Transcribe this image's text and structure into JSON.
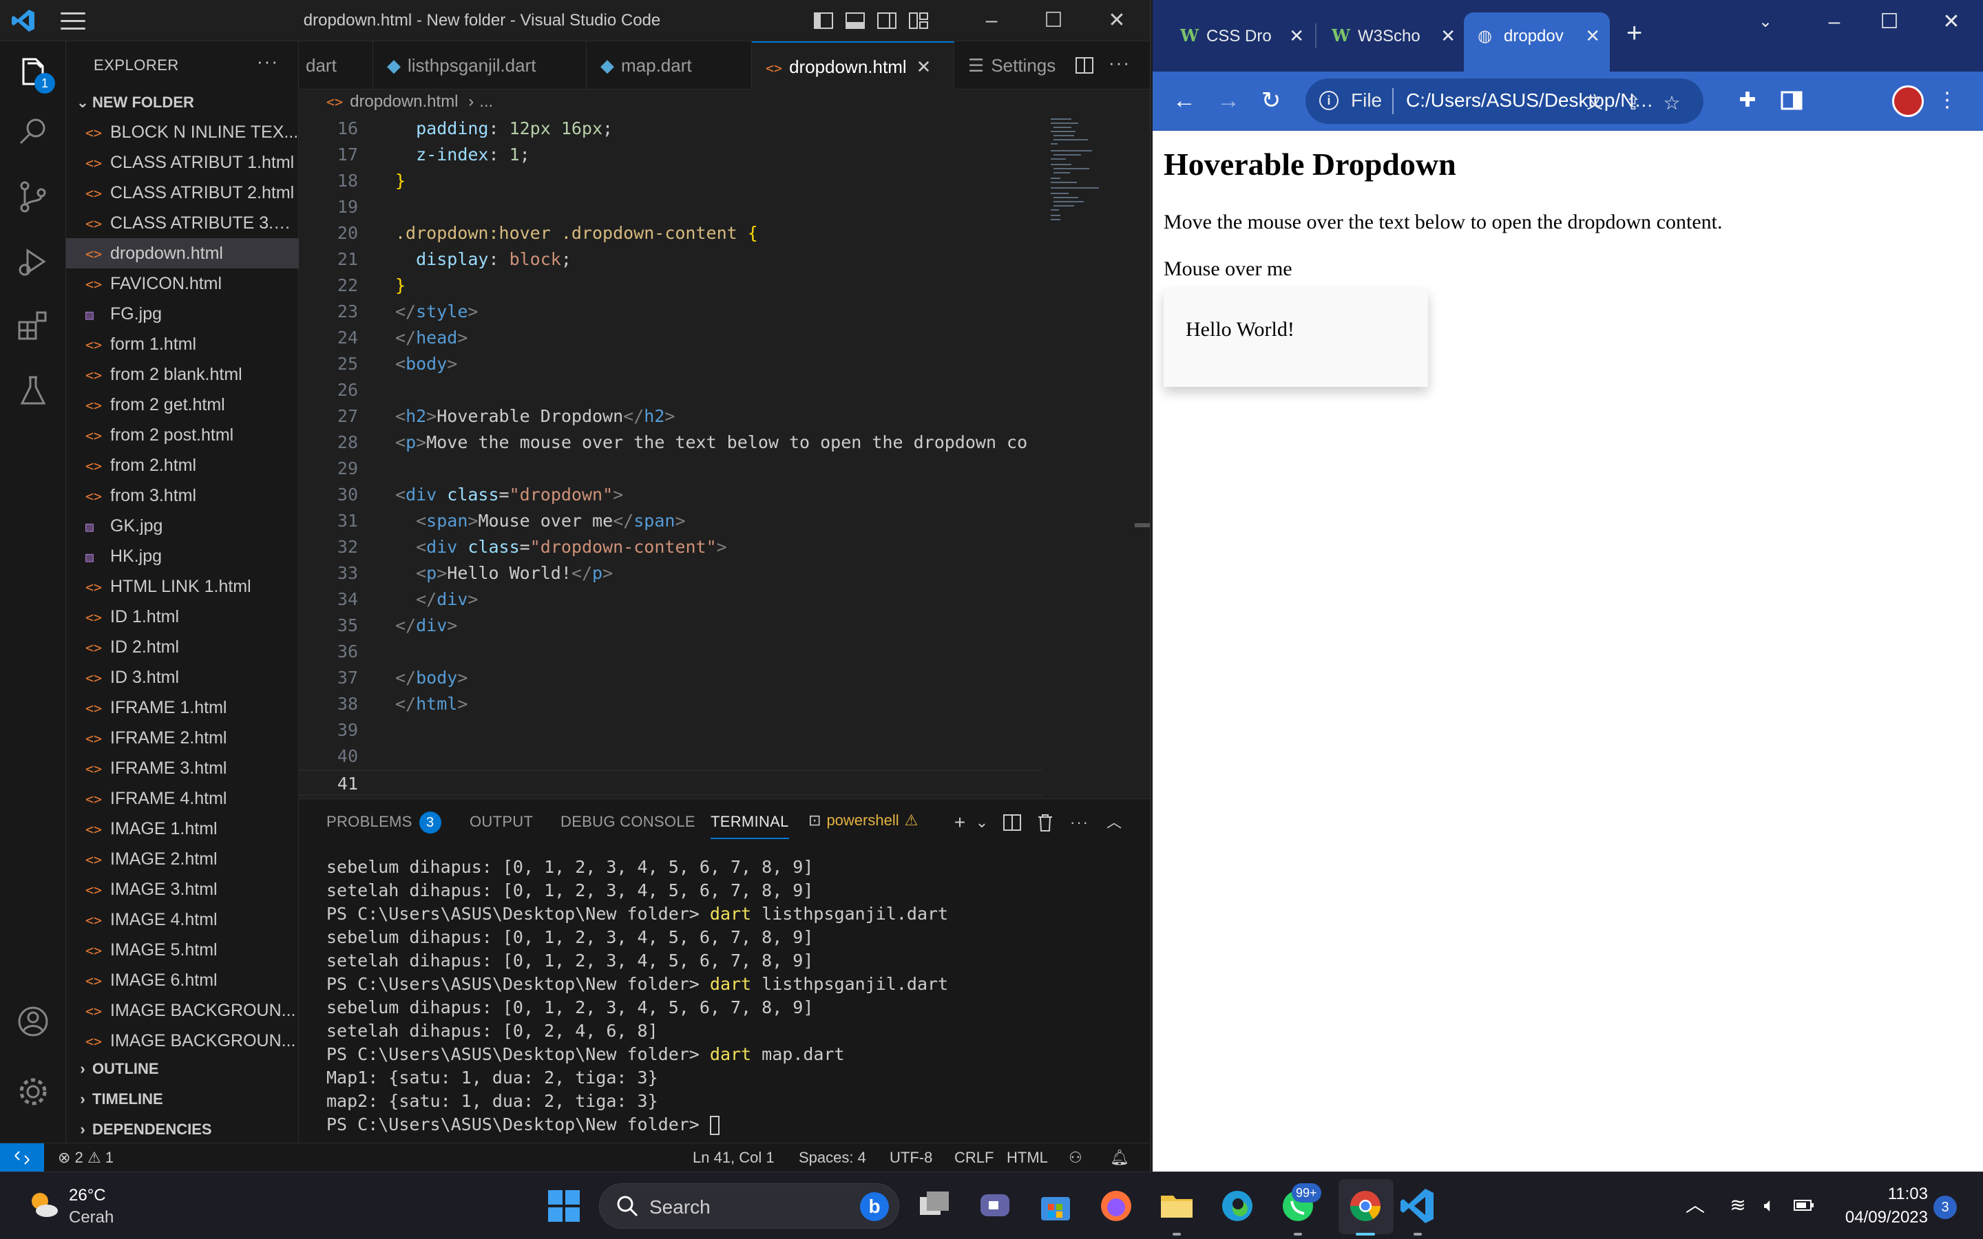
{
  "vscode": {
    "title": "dropdown.html - New folder - Visual Studio Code",
    "explorer_badge": "1",
    "sidebar": {
      "header": "EXPLORER",
      "folder": "NEW FOLDER",
      "files": [
        {
          "name": "BLOCK N INLINE TEX...",
          "type": "html"
        },
        {
          "name": "CLASS ATRIBUT 1.html",
          "type": "html"
        },
        {
          "name": "CLASS ATRIBUT 2.html",
          "type": "html"
        },
        {
          "name": "CLASS ATRIBUTE 3.ht...",
          "type": "html"
        },
        {
          "name": "dropdown.html",
          "type": "html",
          "active": true
        },
        {
          "name": "FAVICON.html",
          "type": "html"
        },
        {
          "name": "FG.jpg",
          "type": "img"
        },
        {
          "name": "form 1.html",
          "type": "html"
        },
        {
          "name": "from 2 blank.html",
          "type": "html"
        },
        {
          "name": "from 2 get.html",
          "type": "html"
        },
        {
          "name": "from 2 post.html",
          "type": "html"
        },
        {
          "name": "from 2.html",
          "type": "html"
        },
        {
          "name": "from 3.html",
          "type": "html"
        },
        {
          "name": "GK.jpg",
          "type": "img"
        },
        {
          "name": "HK.jpg",
          "type": "img"
        },
        {
          "name": "HTML LINK 1.html",
          "type": "html"
        },
        {
          "name": "ID 1.html",
          "type": "html"
        },
        {
          "name": "ID 2.html",
          "type": "html"
        },
        {
          "name": "ID 3.html",
          "type": "html"
        },
        {
          "name": "IFRAME 1.html",
          "type": "html"
        },
        {
          "name": "IFRAME 2.html",
          "type": "html"
        },
        {
          "name": "IFRAME 3.html",
          "type": "html"
        },
        {
          "name": "IFRAME 4.html",
          "type": "html"
        },
        {
          "name": "IMAGE 1.html",
          "type": "html"
        },
        {
          "name": "IMAGE 2.html",
          "type": "html"
        },
        {
          "name": "IMAGE 3.html",
          "type": "html"
        },
        {
          "name": "IMAGE 4.html",
          "type": "html"
        },
        {
          "name": "IMAGE 5.html",
          "type": "html"
        },
        {
          "name": "IMAGE 6.html",
          "type": "html"
        },
        {
          "name": "IMAGE BACKGROUN...",
          "type": "html"
        },
        {
          "name": "IMAGE BACKGROUN...",
          "type": "html"
        }
      ],
      "sections": [
        "OUTLINE",
        "TIMELINE",
        "DEPENDENCIES"
      ]
    },
    "tabs": [
      {
        "label": "dart",
        "icon": "dart"
      },
      {
        "label": "listhpsganjil.dart",
        "icon": "dart"
      },
      {
        "label": "map.dart",
        "icon": "dart"
      },
      {
        "label": "dropdown.html",
        "icon": "html",
        "active": true
      },
      {
        "label": "Settings",
        "icon": "settings"
      }
    ],
    "breadcrumb": [
      "dropdown.html",
      "..."
    ],
    "code_lines": [
      {
        "n": "16",
        "html": "  <span class='t-prop'>padding</span>: <span class='t-num'>12px 16px</span>;"
      },
      {
        "n": "17",
        "html": "  <span class='t-prop'>z-index</span>: <span class='t-num'>1</span>;"
      },
      {
        "n": "18",
        "html": "<span class='t-brace'>}</span>"
      },
      {
        "n": "19",
        "html": ""
      },
      {
        "n": "20",
        "html": "<span class='t-sel'>.dropdown:hover .dropdown-content</span> <span class='t-brace'>{</span>"
      },
      {
        "n": "21",
        "html": "  <span class='t-prop'>display</span>: <span class='t-val'>block</span>;"
      },
      {
        "n": "22",
        "html": "<span class='t-brace'>}</span>"
      },
      {
        "n": "23",
        "html": "<span class='t-brk'>&lt;/</span><span class='t-tag'>style</span><span class='t-brk'>&gt;</span>"
      },
      {
        "n": "24",
        "html": "<span class='t-brk'>&lt;/</span><span class='t-tag'>head</span><span class='t-brk'>&gt;</span>"
      },
      {
        "n": "25",
        "html": "<span class='t-brk'>&lt;</span><span class='t-tag'>body</span><span class='t-brk'>&gt;</span>"
      },
      {
        "n": "26",
        "html": ""
      },
      {
        "n": "27",
        "html": "<span class='t-brk'>&lt;</span><span class='t-tag'>h2</span><span class='t-brk'>&gt;</span>Hoverable Dropdown<span class='t-brk'>&lt;/</span><span class='t-tag'>h2</span><span class='t-brk'>&gt;</span>"
      },
      {
        "n": "28",
        "html": "<span class='t-brk'>&lt;</span><span class='t-tag'>p</span><span class='t-brk'>&gt;</span>Move the mouse over the text below to open the dropdown co"
      },
      {
        "n": "29",
        "html": ""
      },
      {
        "n": "30",
        "html": "<span class='t-brk'>&lt;</span><span class='t-tag'>div</span> <span class='t-attr'>class</span>=<span class='t-str'>\"dropdown\"</span><span class='t-brk'>&gt;</span>"
      },
      {
        "n": "31",
        "html": "  <span class='t-brk'>&lt;</span><span class='t-tag'>span</span><span class='t-brk'>&gt;</span>Mouse over me<span class='t-brk'>&lt;/</span><span class='t-tag'>span</span><span class='t-brk'>&gt;</span>"
      },
      {
        "n": "32",
        "html": "  <span class='t-brk'>&lt;</span><span class='t-tag'>div</span> <span class='t-attr'>class</span>=<span class='t-str'>\"dropdown-content\"</span><span class='t-brk'>&gt;</span>"
      },
      {
        "n": "33",
        "html": "  <span class='t-brk'>&lt;</span><span class='t-tag'>p</span><span class='t-brk'>&gt;</span>Hello World!<span class='t-brk'>&lt;/</span><span class='t-tag'>p</span><span class='t-brk'>&gt;</span>"
      },
      {
        "n": "34",
        "html": "  <span class='t-brk'>&lt;/</span><span class='t-tag'>div</span><span class='t-brk'>&gt;</span>"
      },
      {
        "n": "35",
        "html": "<span class='t-brk'>&lt;/</span><span class='t-tag'>div</span><span class='t-brk'>&gt;</span>"
      },
      {
        "n": "36",
        "html": ""
      },
      {
        "n": "37",
        "html": "<span class='t-brk'>&lt;/</span><span class='t-tag'>body</span><span class='t-brk'>&gt;</span>"
      },
      {
        "n": "38",
        "html": "<span class='t-brk'>&lt;/</span><span class='t-tag'>html</span><span class='t-brk'>&gt;</span>"
      },
      {
        "n": "39",
        "html": ""
      },
      {
        "n": "40",
        "html": ""
      },
      {
        "n": "41",
        "html": "",
        "current": true
      }
    ],
    "panel": {
      "tabs": [
        "PROBLEMS",
        "OUTPUT",
        "DEBUG CONSOLE",
        "TERMINAL"
      ],
      "problems_count": "3",
      "active_tab": "TERMINAL",
      "shell": "powershell",
      "terminal_lines": [
        {
          "text": "sebelum dihapus: [0, 1, 2, 3, 4, 5, 6, 7, 8, 9]"
        },
        {
          "text": "setelah dihapus: [0, 1, 2, 3, 4, 5, 6, 7, 8, 9]"
        },
        {
          "prompt": "PS C:\\Users\\ASUS\\Desktop\\New folder> ",
          "cmd": "dart",
          "args": " listhpsganjil.dart"
        },
        {
          "text": "sebelum dihapus: [0, 1, 2, 3, 4, 5, 6, 7, 8, 9]"
        },
        {
          "text": "setelah dihapus: [0, 1, 2, 3, 4, 5, 6, 7, 8, 9]"
        },
        {
          "prompt": "PS C:\\Users\\ASUS\\Desktop\\New folder> ",
          "cmd": "dart",
          "args": " listhpsganjil.dart"
        },
        {
          "text": "sebelum dihapus: [0, 1, 2, 3, 4, 5, 6, 7, 8, 9]"
        },
        {
          "text": "setelah dihapus: [0, 2, 4, 6, 8]"
        },
        {
          "prompt": "PS C:\\Users\\ASUS\\Desktop\\New folder> ",
          "cmd": "dart",
          "args": " map.dart"
        },
        {
          "text": "Map1: {satu: 1, dua: 2, tiga: 3}"
        },
        {
          "text": "map2: {satu: 1, dua: 2, tiga: 3}"
        },
        {
          "prompt": "PS C:\\Users\\ASUS\\Desktop\\New folder> ",
          "cursor": true
        }
      ]
    },
    "status": {
      "errors": "2",
      "warnings": "1",
      "position": "Ln 41, Col 1",
      "spaces": "Spaces: 4",
      "encoding": "UTF-8",
      "eol": "CRLF",
      "language": "HTML"
    }
  },
  "browser": {
    "tabs": [
      {
        "label": "CSS Dro",
        "icon": "w3schools"
      },
      {
        "label": "W3Scho",
        "icon": "w3schools"
      },
      {
        "label": "dropdov",
        "icon": "globe",
        "active": true
      }
    ],
    "omnibox": {
      "scheme": "File",
      "url": "C:/Users/ASUS/Desktop/Ne..."
    },
    "page": {
      "heading": "Hoverable Dropdown",
      "description": "Move the mouse over the text below to open the dropdown content.",
      "hover_text": "Mouse over me",
      "dropdown_text": "Hello World!"
    }
  },
  "taskbar": {
    "weather_temp": "26°C",
    "weather_cond": "Cerah",
    "search_placeholder": "Search",
    "whatsapp_badge": "99+",
    "time": "11:03",
    "date": "04/09/2023",
    "notifications": "3"
  },
  "colors": {
    "accent": "#0078d4",
    "browser_frame": "#3367c7",
    "terminal_cmd": "#f1e05a"
  }
}
